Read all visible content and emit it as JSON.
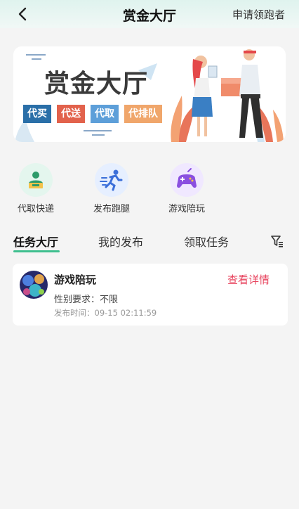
{
  "header": {
    "title": "赏金大厅",
    "apply_label": "申请领跑者"
  },
  "banner": {
    "title": "赏金大厅",
    "tags": [
      {
        "label": "代买",
        "color": "#2a6fa8"
      },
      {
        "label": "代送",
        "color": "#e2624c"
      },
      {
        "label": "代取",
        "color": "#5d9fd9"
      },
      {
        "label": "代排队",
        "color": "#f0a66b"
      }
    ]
  },
  "categories": [
    {
      "label": "代取快递",
      "icon": "courier-icon"
    },
    {
      "label": "发布跑腿",
      "icon": "runner-icon"
    },
    {
      "label": "游戏陪玩",
      "icon": "gamepad-icon"
    }
  ],
  "tabs": [
    {
      "label": "任务大厅"
    },
    {
      "label": "我的发布"
    },
    {
      "label": "领取任务"
    }
  ],
  "task": {
    "title": "游戏陪玩",
    "detail_label": "查看详情",
    "gender_requirement": "性别要求：不限",
    "publish_time": "发布时间：09-15 02:11:59"
  },
  "colors": {
    "accent": "#3fbf8f",
    "detail": "#e8455f"
  }
}
